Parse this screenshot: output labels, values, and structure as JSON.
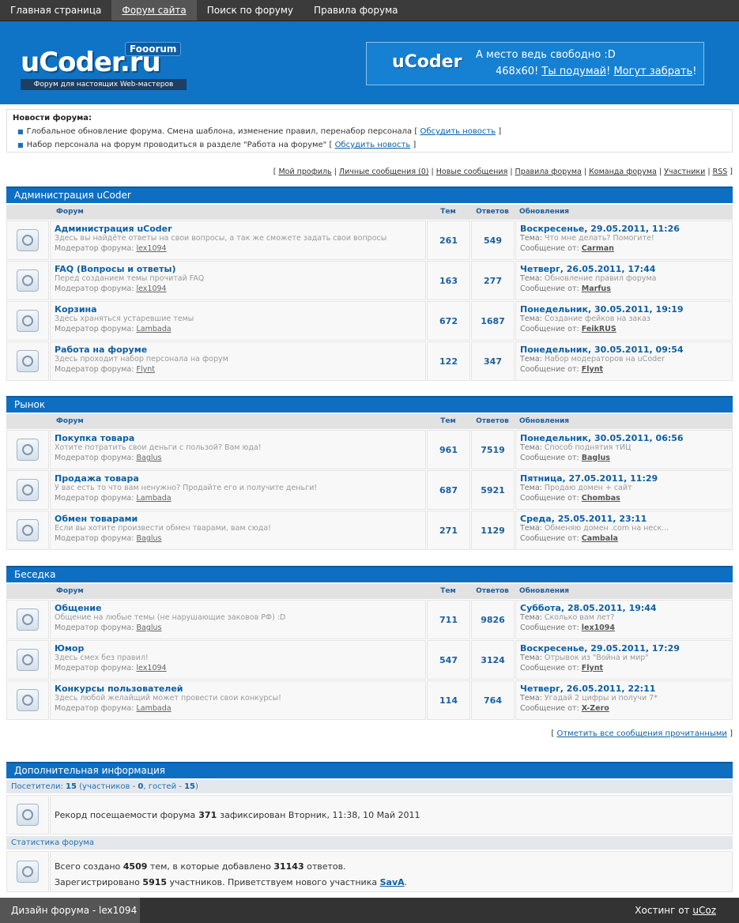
{
  "nav": {
    "items": [
      "Главная страница",
      "Форум сайта",
      "Поиск по форуму",
      "Правила форума"
    ],
    "active_index": 1
  },
  "header": {
    "logo_text": "uCoder.ru",
    "logo_badge": "Fooorum",
    "logo_tagline": "Форум для настоящих Web-мастеров",
    "banner_brand": "uCoder",
    "banner_line1": "А место ведь свободно :D",
    "banner_size": "468x60!",
    "banner_link1": "Ты подумай",
    "banner_link2": "Могут забрать",
    "banner_link2_suffix": "!"
  },
  "news": {
    "title": "Новости форума:",
    "items": [
      {
        "text": "Глобальное обновление форума. Смена шаблона, изменение правил, перенабор персонала",
        "link": "Обсудить новость"
      },
      {
        "text": "Набор персонала на форум проводиться в разделе \"Работа на форуме\"",
        "link": "Обсудить новость"
      }
    ]
  },
  "userlinks": [
    "Мой профиль",
    "Личные сообщения (0)",
    "Новые сообщения",
    "Правила форума",
    "Команда форума",
    "Участники",
    "RSS"
  ],
  "columns": {
    "forum": "Форум",
    "topics": "Тем",
    "replies": "Ответов",
    "updates": "Обновления"
  },
  "labels": {
    "moderator": "Модератор форума:",
    "topic": "Тема:",
    "message_from": "Сообщение от:"
  },
  "categories": [
    {
      "title": "Администрация uCoder",
      "forums": [
        {
          "name": "Администрация uCoder",
          "desc": "Здесь вы найдёте ответы на свои вопросы, а так же сможете задать свои вопросы",
          "moderator": "lex1094",
          "topics": "261",
          "replies": "549",
          "date": "Воскресенье, 29.05.2011, 11:26",
          "topic": "Что мне делать? Помогите!",
          "author": "Carman"
        },
        {
          "name": "FAQ (Вопросы и ответы)",
          "desc": "Перед созданием темы прочитай FAQ",
          "moderator": "lex1094",
          "topics": "163",
          "replies": "277",
          "date": "Четверг, 26.05.2011, 17:44",
          "topic": "Обновление правил форума",
          "author": "Marfus"
        },
        {
          "name": "Корзина",
          "desc": "Здесь храняться устаревшие темы",
          "moderator": "Lambada",
          "topics": "672",
          "replies": "1687",
          "date": "Понедельник, 30.05.2011, 19:19",
          "topic": "Создание фейков на заказ",
          "author": "FeikRUS"
        },
        {
          "name": "Работа на форуме",
          "desc": "Здесь проходит набор персонала на форум",
          "moderator": "Flynt",
          "topics": "122",
          "replies": "347",
          "date": "Понедельник, 30.05.2011, 09:54",
          "topic": "Набор модераторов на uCoder",
          "author": "Flynt"
        }
      ]
    },
    {
      "title": "Рынок",
      "forums": [
        {
          "name": "Покупка товара",
          "desc": "Хотите потратить свои деньги с пользой? Вам юда!",
          "moderator": "Baglus",
          "topics": "961",
          "replies": "7519",
          "date": "Понедельник, 30.05.2011, 06:56",
          "topic": "Способ поднятия тИЦ",
          "author": "Baglus"
        },
        {
          "name": "Продажа товара",
          "desc": "У вас есть то что вам ненужно? Продайте его и получите деньги!",
          "moderator": "Lambada",
          "topics": "687",
          "replies": "5921",
          "date": "Пятница, 27.05.2011, 11:29",
          "topic": "Продаю домен + сайт",
          "author": "Chombas"
        },
        {
          "name": "Обмен товарами",
          "desc": "Если вы хотите произвести обмен тварами, вам сюда!",
          "moderator": "Baglus",
          "topics": "271",
          "replies": "1129",
          "date": "Среда, 25.05.2011, 23:11",
          "topic": "Обменяю домен .com на неск...",
          "author": "Cambala"
        }
      ]
    },
    {
      "title": "Беседка",
      "forums": [
        {
          "name": "Общение",
          "desc": "Общение на любые темы (не нарушающие заковов РФ) :D",
          "moderator": "Baglus",
          "topics": "711",
          "replies": "9826",
          "date": "Суббота, 28.05.2011, 19:44",
          "topic": "Сколько вам лет?",
          "author": "lex1094"
        },
        {
          "name": "Юмор",
          "desc": "Здесь смех без правил!",
          "moderator": "lex1094",
          "topics": "547",
          "replies": "3124",
          "date": "Воскресенье, 29.05.2011, 17:29",
          "topic": "Отрывок из \"Война и мир\"",
          "author": "Flynt"
        },
        {
          "name": "Конкурсы пользователей",
          "desc": "Здесь любой желайщий может провести свои конкурсы!",
          "moderator": "Lambada",
          "topics": "114",
          "replies": "764",
          "date": "Четверг, 26.05.2011, 22:11",
          "topic": "Угадай 2 цифры и получи 7*",
          "author": "X-Zero"
        }
      ]
    }
  ],
  "markread": "Отметить все сообщения прочитанными",
  "extra": {
    "title": "Дополнительная информация",
    "visitors_prefix": "Посетители:",
    "visitors_total": "15",
    "visitors_members_label": "(участников -",
    "visitors_members": "0",
    "visitors_guests_label": ", гостей -",
    "visitors_guests": "15",
    "visitors_suffix": ")",
    "record_prefix": "Рекорд посещаемости форума",
    "record_value": "371",
    "record_suffix": "зафиксирован Вторник, 11:38, 10 Май 2011",
    "stats_title": "Статистика форума",
    "stats_line1_prefix": "Всего создано",
    "stats_topics": "4509",
    "stats_line1_mid": "тем, в которые добавлено",
    "stats_replies": "31143",
    "stats_line1_suffix": "ответов.",
    "stats_line2_prefix": "Зарегистрировано",
    "stats_users": "5915",
    "stats_line2_mid": "участников. Приветствуем нового участника",
    "stats_newuser": "SavA",
    "stats_line2_suffix": "."
  },
  "footer": {
    "left": "Дизайн форума - lex1094",
    "right_prefix": "Хостинг от",
    "right_link": "uCoz"
  }
}
